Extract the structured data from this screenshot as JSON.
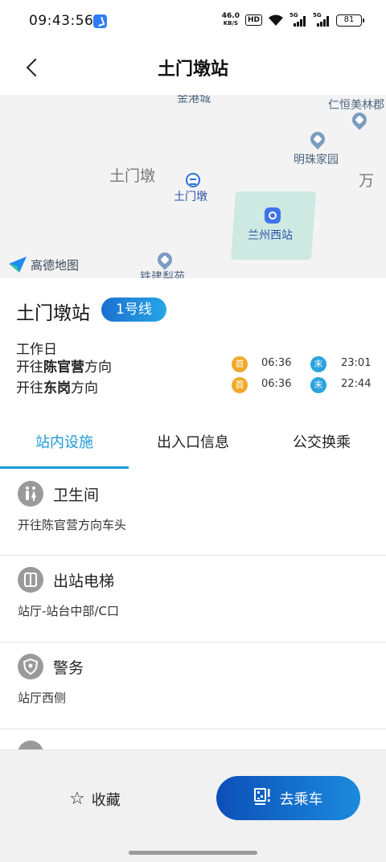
{
  "status_bar": {
    "time": "09:43:56",
    "net_speed_value": "46.0",
    "net_speed_unit": "KB/S",
    "hd_label": "HD",
    "signal1_label": "5G",
    "signal2_label": "5G",
    "battery": "81"
  },
  "header": {
    "title": "土门墩站",
    "back_icon": "chevron-left-icon"
  },
  "map": {
    "labels": {
      "top_partial": "金港城",
      "poi_renheng": "仁恒美林郡",
      "poi_mingzhu": "明珠家园",
      "area_tumendun": "土门墩",
      "area_wan": "万",
      "station_tumendun": "土门墩",
      "station_lanzhouxi": "兰州西站",
      "poi_tiejian": "铁建梨苑"
    },
    "logo_text": "高德地图"
  },
  "station": {
    "name": "土门墩站",
    "line_badge": "1号线",
    "day_type": "工作日",
    "directions": [
      {
        "prefix": "开往",
        "dest": "陈官营",
        "suffix": "方向",
        "first_tag": "首",
        "first_time": "06:36",
        "last_tag": "末",
        "last_time": "23:01"
      },
      {
        "prefix": "开往",
        "dest": "东岗",
        "suffix": "方向",
        "first_tag": "首",
        "first_time": "06:36",
        "last_tag": "末",
        "last_time": "22:44"
      }
    ]
  },
  "tabs": [
    {
      "label": "站内设施",
      "active": true
    },
    {
      "label": "出入口信息",
      "active": false
    },
    {
      "label": "公交换乘",
      "active": false
    }
  ],
  "facilities": [
    {
      "title": "卫生间",
      "desc": "开往陈官营方向车头",
      "icon": "restroom-icon"
    },
    {
      "title": "出站电梯",
      "desc": "站厅-站台中部/C口",
      "icon": "elevator-icon"
    },
    {
      "title": "警务",
      "desc": "站厅西侧",
      "icon": "police-shield-icon"
    }
  ],
  "bottom": {
    "favorite_label": "收藏",
    "favorite_icon": "star-icon",
    "ride_label": "去乘车",
    "ride_icon": "qr-code-icon"
  },
  "colors": {
    "accent": "#1c9ad6",
    "line_badge_start": "#1a6fd0",
    "line_badge_end": "#27a6e6",
    "first_train": "#f0a928",
    "last_train": "#2aa3de"
  }
}
